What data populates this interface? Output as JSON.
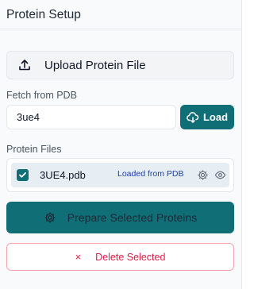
{
  "panel": {
    "title": "Protein Setup",
    "upload": {
      "label": "Upload Protein File",
      "icon": "upload-icon"
    },
    "fetch": {
      "label": "Fetch from PDB",
      "input_value": "3ue4",
      "load_label": "Load",
      "load_icon": "cloud-download-icon"
    },
    "files": {
      "label": "Protein Files",
      "items": [
        {
          "name": "3UE4.pdb",
          "checked": true,
          "badge": "Loaded from PDB"
        }
      ]
    },
    "prepare": {
      "label": "Prepare Selected Proteins",
      "icon": "gear-icon"
    },
    "delete": {
      "icon_text": "×",
      "label": "Delete Selected"
    }
  },
  "colors": {
    "accent": "#0f6e76",
    "danger": "#e11d48",
    "danger_border": "#f8a3ac",
    "row_bg": "#e6eef3"
  }
}
